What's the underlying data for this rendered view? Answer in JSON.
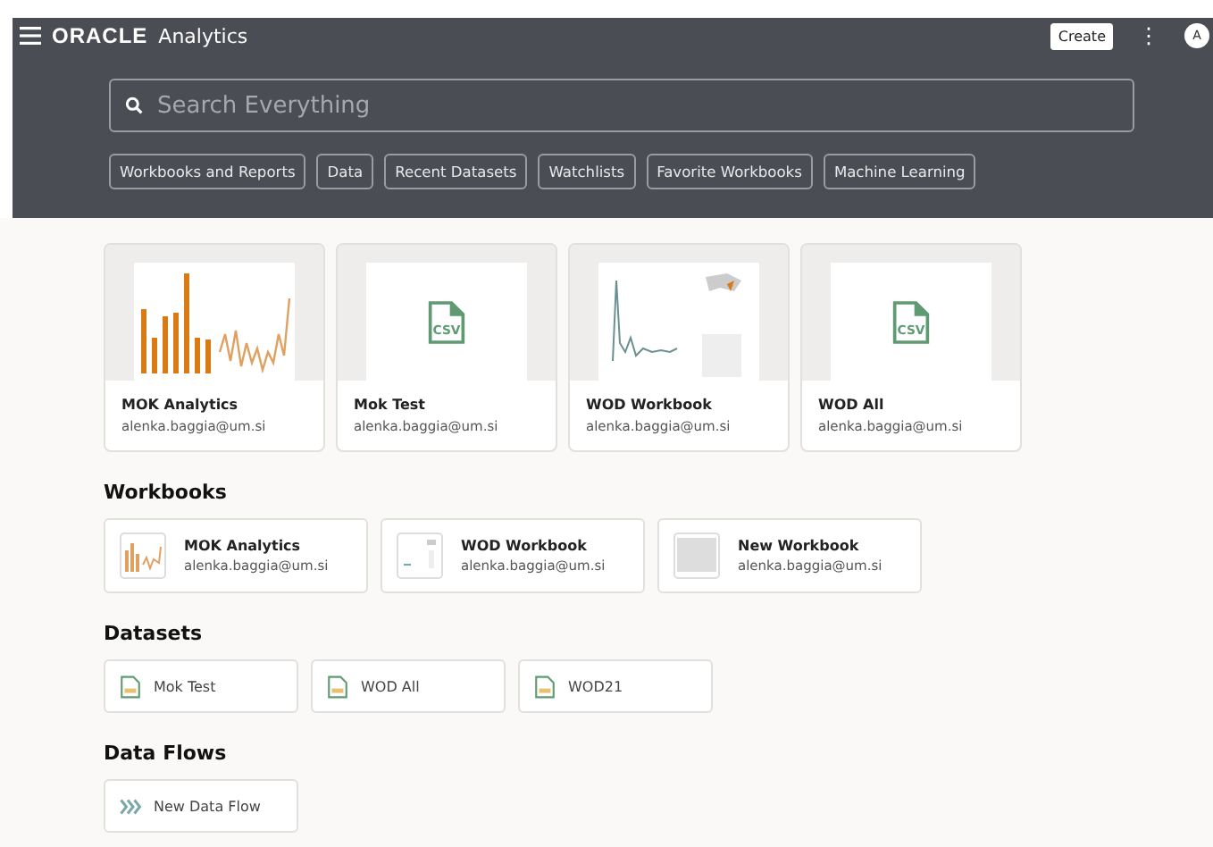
{
  "header": {
    "logo": "ORACLE",
    "product": "Analytics",
    "create_button": "Create",
    "menu_glyph": "⋮",
    "avatar": "A"
  },
  "search": {
    "placeholder": "Search Everything"
  },
  "filters": [
    "Workbooks and Reports",
    "Data",
    "Recent Datasets",
    "Watchlists",
    "Favorite Workbooks",
    "Machine Learning"
  ],
  "recent": [
    {
      "kind": "workbook",
      "title": "MOK Analytics",
      "owner": "alenka.baggia@um.si"
    },
    {
      "kind": "dataset",
      "icon_label": "CSV",
      "title": "Mok Test",
      "owner": "alenka.baggia@um.si"
    },
    {
      "kind": "map",
      "title": "WOD Workbook",
      "owner": "alenka.baggia@um.si"
    },
    {
      "kind": "dataset",
      "icon_label": "CSV",
      "title": "WOD All",
      "owner": "alenka.baggia@um.si"
    }
  ],
  "workbooks": {
    "heading": "Workbooks",
    "items": [
      {
        "kind": "workbook",
        "title": "MOK Analytics",
        "owner": "alenka.baggia@um.si"
      },
      {
        "kind": "map",
        "title": "WOD Workbook",
        "owner": "alenka.baggia@um.si"
      },
      {
        "kind": "blank",
        "title": "New Workbook",
        "owner": "alenka.baggia@um.si"
      }
    ]
  },
  "datasets": {
    "heading": "Datasets",
    "items": [
      {
        "title": "Mok Test"
      },
      {
        "title": "WOD All"
      },
      {
        "title": "WOD21"
      }
    ]
  },
  "data_flows": {
    "heading": "Data Flows",
    "items": [
      {
        "title": "New Data Flow"
      }
    ]
  }
}
